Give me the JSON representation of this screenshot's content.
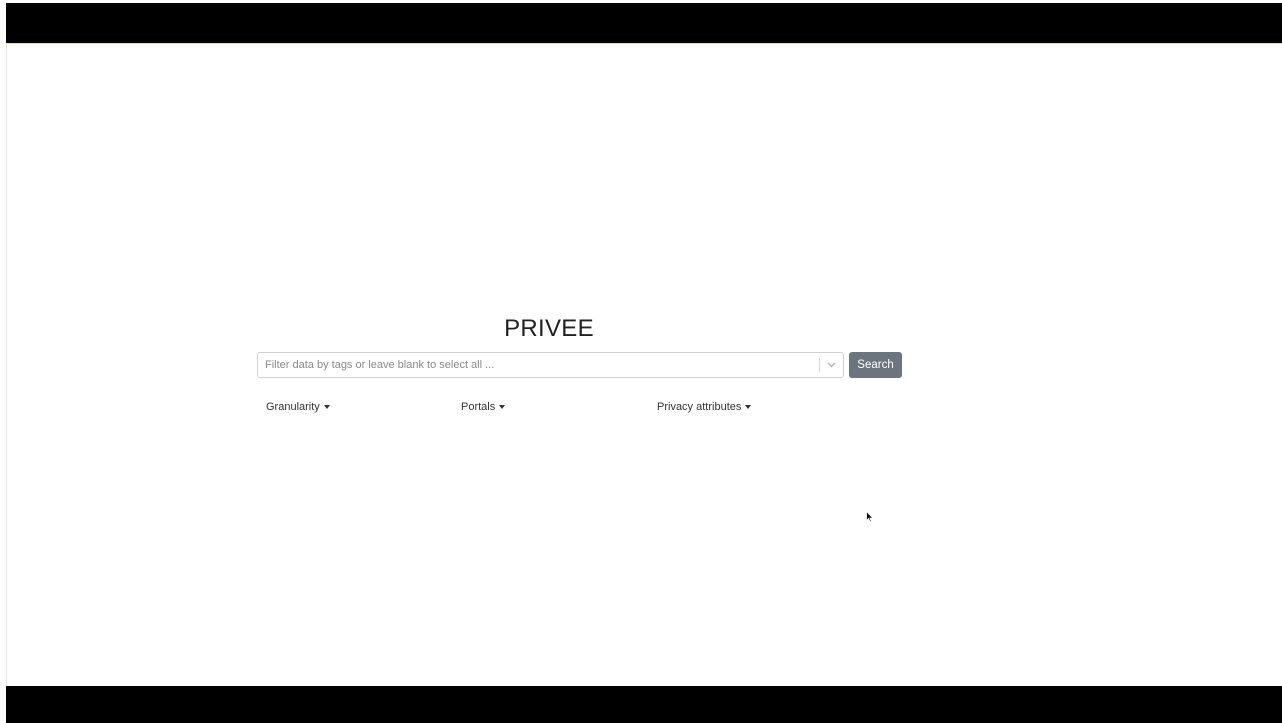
{
  "app": {
    "title": "PRIVEE"
  },
  "search": {
    "placeholder": "Filter data by tags or leave blank to select all ...",
    "value": "",
    "button_label": "Search",
    "button_color": "#6c757d"
  },
  "filters": [
    {
      "label": "Granularity",
      "icon": "caret-down-icon"
    },
    {
      "label": "Portals",
      "icon": "caret-down-icon"
    },
    {
      "label": "Privacy attributes",
      "icon": "caret-down-icon"
    }
  ],
  "colors": {
    "letterbox": "#000000",
    "background": "#ffffff",
    "text": "#222222"
  }
}
